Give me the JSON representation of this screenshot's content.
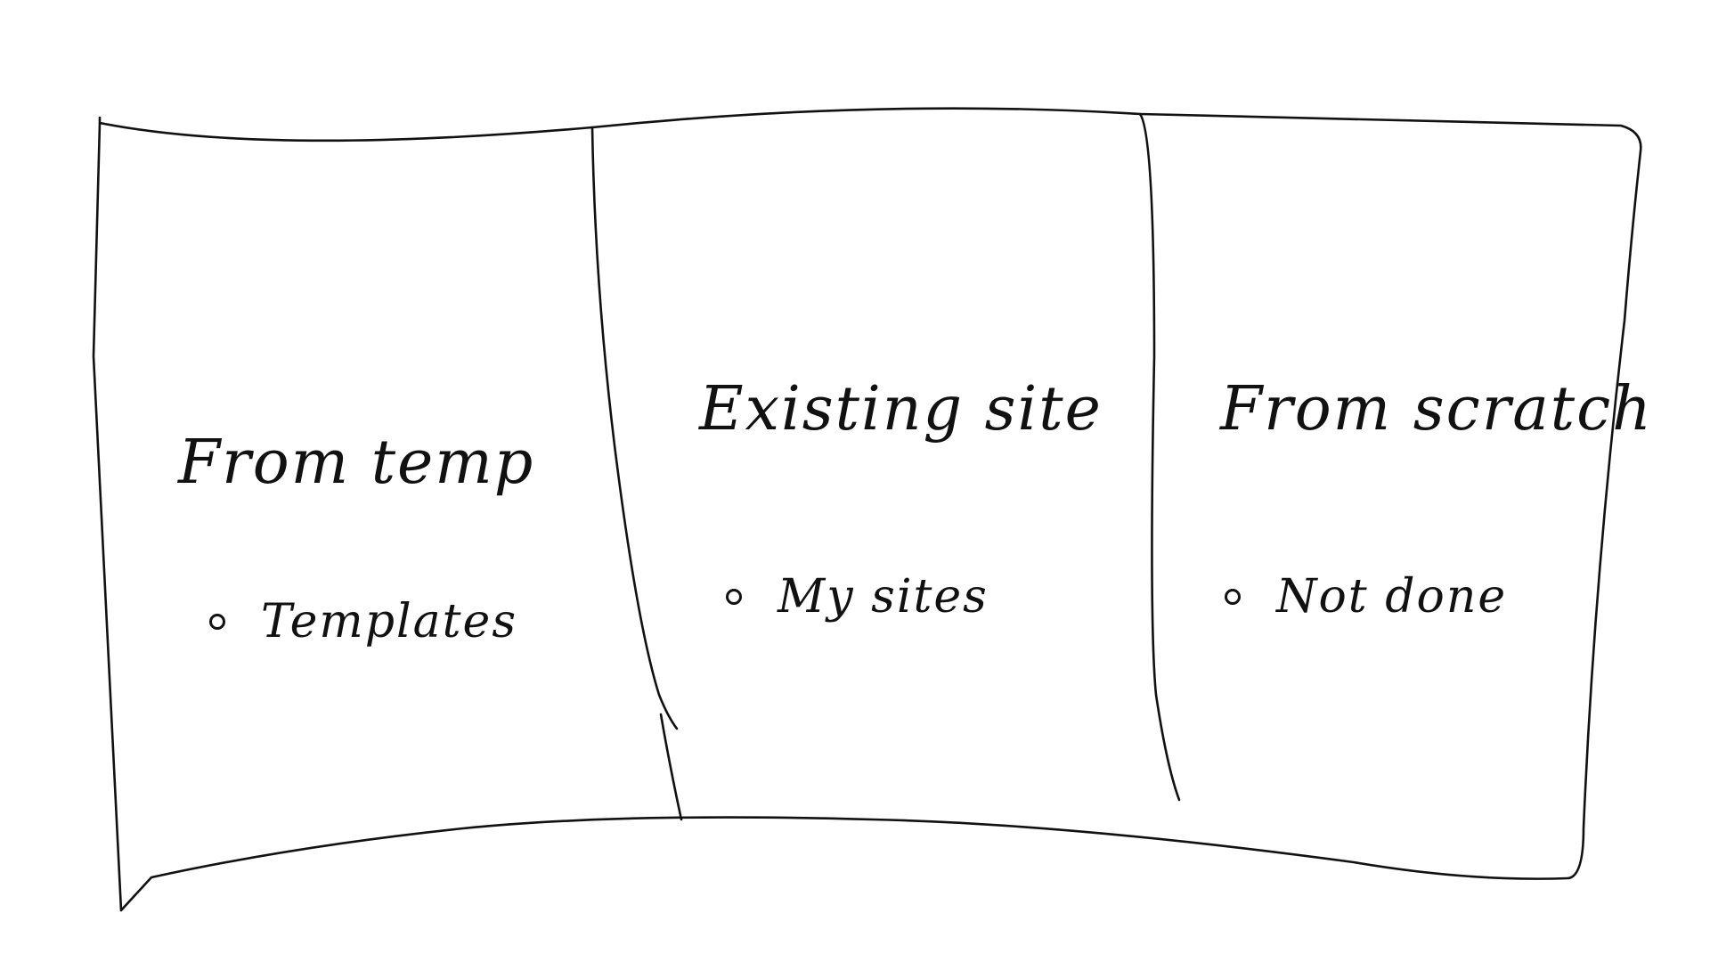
{
  "panels": [
    {
      "title": "From temp",
      "item": "Templates"
    },
    {
      "title": "Existing site",
      "item": "My sites"
    },
    {
      "title": "From scratch",
      "item": "Not done"
    }
  ]
}
